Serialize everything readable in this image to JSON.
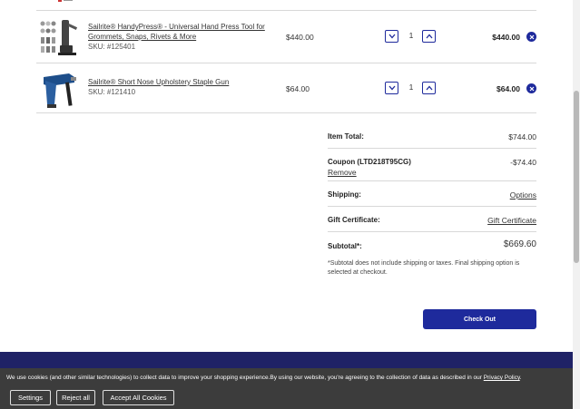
{
  "cart": {
    "items": [
      {
        "name": "Sailrite® HandyPress® - Universal Hand Press Tool for Grommets, Snaps, Rivets & More",
        "sku": "SKU: #125401",
        "unit_price": "$440.00",
        "qty": "1",
        "line_total": "$440.00"
      },
      {
        "name": "Sailrite® Short Nose Upholstery Staple Gun",
        "sku": "SKU: #121410",
        "unit_price": "$64.00",
        "qty": "1",
        "line_total": "$64.00"
      }
    ]
  },
  "summary": {
    "item_total_label": "Item Total:",
    "item_total_value": "$744.00",
    "coupon_label": "Coupon (LTD218T95CG)",
    "coupon_value": "-$74.40",
    "coupon_remove": "Remove",
    "shipping_label": "Shipping:",
    "shipping_value": "Options",
    "gift_label": "Gift Certificate:",
    "gift_value": "Gift Certificate",
    "subtotal_label": "Subtotal*:",
    "subtotal_value": "$669.60",
    "note": "*Subtotal does not include shipping or taxes. Final shipping option is selected at checkout."
  },
  "checkout": {
    "label": "Check Out"
  },
  "cookie": {
    "text": "We use cookies (and other similar technologies) to collect data to improve your shopping experience.By using our website, you're agreeing to the collection of data as described in our ",
    "policy_link": "Privacy Policy",
    "period": ".",
    "settings": "Settings",
    "reject": "Reject all",
    "accept": "Accept All Cookies"
  },
  "colors": {
    "accent": "#1e2a9c",
    "footer": "#1f2266",
    "cookie_bg": "#3c3c3c"
  },
  "icons": {
    "qty_minus": "chevron-down-icon",
    "qty_plus": "chevron-up-icon",
    "remove": "close-icon"
  }
}
